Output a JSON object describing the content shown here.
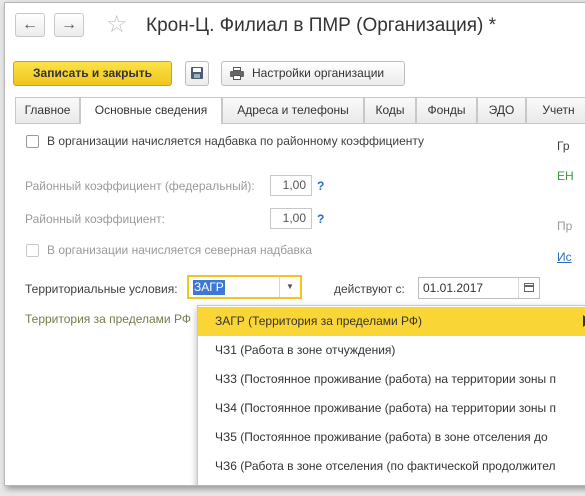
{
  "window": {
    "title": "Крон-Ц. Филиал в ПМР (Организация) *",
    "nav": {
      "back_icon": "←",
      "forward_icon": "→"
    },
    "star_icon": "☆"
  },
  "toolbar": {
    "save_close_label": "Записать и закрыть",
    "settings_label": "Настройки организации"
  },
  "tabs": [
    "Главное",
    "Основные сведения",
    "Адреса и телефоны",
    "Коды",
    "Фонды",
    "ЭДО",
    "Учетн"
  ],
  "active_tab": "Основные сведения",
  "form": {
    "regional_allowance_label": "В организации начисляется надбавка по районному коэффициенту",
    "regional_allowance_checked": false,
    "federal_coef_label": "Районный коэффициент (федеральный):",
    "federal_coef_value": "1,00",
    "coef_label": "Районный коэффициент:",
    "coef_value": "1,00",
    "question_mark": "?",
    "north_allowance_label": "В организации начисляется северная надбавка",
    "north_allowance_checked": false,
    "territorial_label": "Территориальные условия:",
    "territorial_value": "ЗАГР",
    "valid_from_label": "действуют с:",
    "valid_from_value": "01.01.2017",
    "territory_hint": "Территория за пределами РФ"
  },
  "right_column": {
    "line1": "Гр",
    "line2": "ЕН",
    "line3": "Пр",
    "line4": "Ис"
  },
  "dropdown": {
    "items": [
      "ЗАГР (Территория за пределами РФ)",
      "ЧЗ1 (Работа в зоне отчуждения)",
      "ЧЗ3 (Постоянное проживание (работа) на территории зоны п",
      "ЧЗ4 (Постоянное проживание (работа) на территории зоны п",
      "ЧЗ5 (Постоянное проживание (работа) в зоне отселения до",
      "ЧЗ6 (Работа в зоне отселения (по фактической продолжител"
    ],
    "highlighted_index": 0
  },
  "colors": {
    "accent_yellow": "#f9d535",
    "selection_blue": "#3c78d8",
    "link_blue": "#2b6bbd",
    "green_text": "#3c9a3c"
  }
}
